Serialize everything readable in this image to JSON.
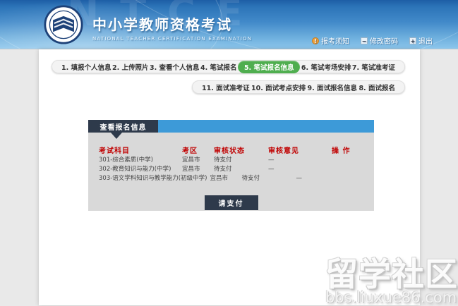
{
  "header": {
    "title": "中小学教师资格考试",
    "subtitle": "NATIONAL TEACHER CERTIFICATION EXAMINATION",
    "background_watermark": "NTCE",
    "links": [
      {
        "label": "报考须知",
        "icon": "notice-icon"
      },
      {
        "label": "修改密码",
        "icon": "password-icon"
      },
      {
        "label": "退出",
        "icon": "logout-icon"
      }
    ]
  },
  "nav": {
    "row1": [
      {
        "label": "1. 填报个人信息",
        "active": false
      },
      {
        "label": "2. 上传照片",
        "active": false
      },
      {
        "label": "3. 查看个人信息",
        "active": false
      },
      {
        "label": "4. 笔试报名",
        "active": false
      },
      {
        "label": "5. 笔试报名信息",
        "active": true
      },
      {
        "label": "6. 笔试考场安排",
        "active": false
      },
      {
        "label": "7. 笔试准考证",
        "active": false
      }
    ],
    "row2": [
      {
        "label": "11. 面试准考证"
      },
      {
        "label": "10. 面试考点安排"
      },
      {
        "label": "9. 面试报名信息"
      },
      {
        "label": "8. 面试报名"
      }
    ]
  },
  "panel": {
    "tab_label": "查看报名信息",
    "table": {
      "headers": [
        "考试科目",
        "考区",
        "审核状态",
        "审核意见",
        "操 作"
      ],
      "rows": [
        {
          "subject": "301-综合素质(中学)",
          "region": "宜昌市",
          "status": "待支付",
          "opinion": "—"
        },
        {
          "subject": "302-教育知识与能力(中学)",
          "region": "宜昌市",
          "status": "待支付",
          "opinion": "—"
        },
        {
          "subject": "303-语文学科知识与教学能力(初级中学)",
          "region": "宜昌市",
          "status": "待支付",
          "opinion": "—"
        }
      ]
    },
    "pay_button": "请支付"
  },
  "site_watermark": {
    "line1": "留学社区",
    "line2": "bbs.liuxue86.com"
  },
  "colors": {
    "banner_blue": "#4189c9",
    "active_green": "#4fae4f",
    "tab_dark": "#2e3a4b",
    "tab_blue": "#3d9ad8",
    "header_red": "#c00000",
    "panel_gray": "#d9d9d9"
  }
}
